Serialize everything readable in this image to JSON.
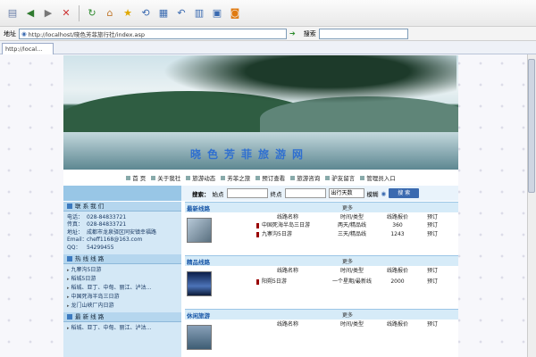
{
  "browser": {
    "address_label": "地址",
    "address_value": "http://localhost/晓色芳菲旅行社/index.asp",
    "search_label": "搜索",
    "tab_label": "http://local..."
  },
  "site": {
    "banner_title": "晓色芳菲旅游网",
    "nav": [
      "首 页",
      "关于我社",
      "旅游动态",
      "芳菲之旅",
      "预订查看",
      "旅游咨询",
      "驴友留言",
      "管理员入口"
    ],
    "search": {
      "label": "搜索：",
      "start_label": "始点",
      "end_label": "终点",
      "days_select": "出行天数",
      "auto_label": "模糊",
      "button": "搜 索"
    },
    "left": {
      "contact_title": "联 系 我 们",
      "contact": [
        {
          "k": "电话：",
          "v": "028-84833721"
        },
        {
          "k": "传真：",
          "v": "028-84833721"
        },
        {
          "k": "地址：",
          "v": "成都市龙泉驿区同安镇幸福路"
        },
        {
          "k": "Email：",
          "v": "cheff1168@163.com"
        },
        {
          "k": "QQ：",
          "v": "54299455"
        }
      ],
      "hot_title": "热 线 线 路",
      "hot_items": [
        "九寨沟5日游",
        "稻城5日游",
        "稻城、亚丁、中甸、丽江、泸沽...",
        "中国死海半岛三日游",
        "龙门山峡厂内日游"
      ],
      "new_title": "最 新 线 路",
      "new_items": [
        "稻城、亚丁、中甸、丽江、泸沽..."
      ]
    },
    "sections": [
      {
        "title": "最新线路",
        "more": "更多",
        "headers": [
          "线路名称",
          "时间/类型",
          "线路报价",
          "预订"
        ],
        "rows": [
          {
            "name": "中国死海半岛三日游",
            "time": "两天/精品线",
            "price": "360",
            "book": "预订"
          },
          {
            "name": "九寨沟5日游",
            "time": "三天/精品线",
            "price": "1243",
            "book": "预订"
          }
        ]
      },
      {
        "title": "精品线路",
        "more": "更多",
        "headers": [
          "线路名称",
          "时间/类型",
          "线路报价",
          "预订"
        ],
        "rows": [
          {
            "name": "阳朔5日游",
            "time": "一个星期/最新线",
            "price": "2000",
            "book": "预订"
          }
        ]
      },
      {
        "title": "休闲旅游",
        "more": "更多",
        "headers": [
          "线路名称",
          "时间/类型",
          "线路报价",
          "预订"
        ],
        "rows": []
      }
    ]
  }
}
